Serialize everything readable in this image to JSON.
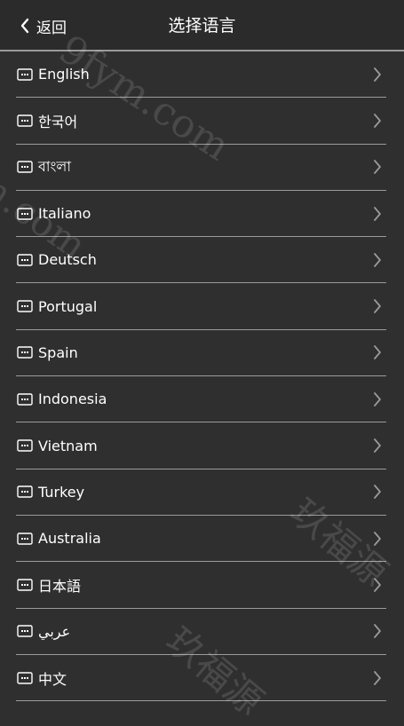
{
  "header": {
    "back_label": "返回",
    "title": "选择语言"
  },
  "languages": [
    {
      "label": "English"
    },
    {
      "label": "한국어"
    },
    {
      "label": "বাংলা"
    },
    {
      "label": "Italiano"
    },
    {
      "label": "Deutsch"
    },
    {
      "label": "Portugal"
    },
    {
      "label": "Spain"
    },
    {
      "label": "Indonesia"
    },
    {
      "label": "Vietnam"
    },
    {
      "label": "Turkey"
    },
    {
      "label": "Australia"
    },
    {
      "label": "日本語"
    },
    {
      "label": "عربي"
    },
    {
      "label": "中文"
    }
  ],
  "watermarks": {
    "top": "9fym.com",
    "left": "m.com",
    "bottom_right": "玖福源",
    "bottom_middle": "玖福源"
  },
  "colors": {
    "background": "#2f2f2f",
    "header_background": "#2b2b2b",
    "divider": "#9b9b9b",
    "text": "#ffffff"
  },
  "icons": {
    "back": "chevron-left-icon",
    "item": "keyboard-icon",
    "row_arrow": "chevron-right-icon"
  }
}
